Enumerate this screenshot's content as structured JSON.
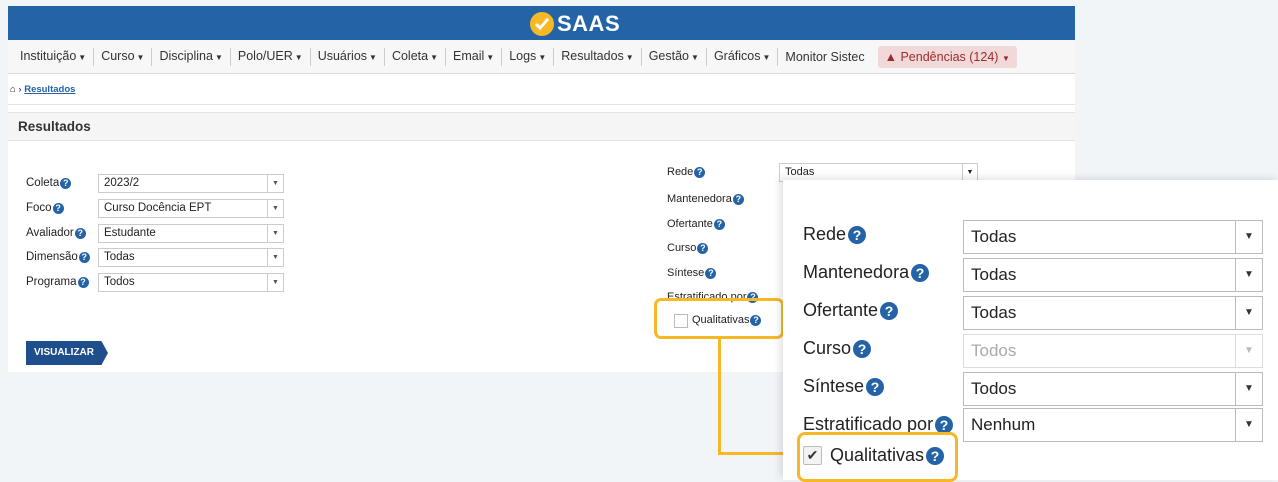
{
  "app": {
    "logo_text": "SAAS"
  },
  "nav": {
    "items": [
      "Instituição",
      "Curso",
      "Disciplina",
      "Polo/UER",
      "Usuários",
      "Coleta",
      "Email",
      "Logs",
      "Resultados",
      "Gestão",
      "Gráficos"
    ],
    "monitor": "Monitor Sistec",
    "pendencias": "Pendências (124)"
  },
  "breadcrumb": {
    "current": "Resultados"
  },
  "page": {
    "title": "Resultados"
  },
  "left_form": {
    "coleta": {
      "label": "Coleta",
      "value": "2023/2"
    },
    "foco": {
      "label": "Foco",
      "value": "Curso Docência EPT"
    },
    "avaliador": {
      "label": "Avaliador",
      "value": "Estudante"
    },
    "dimensao": {
      "label": "Dimensão",
      "value": "Todas"
    },
    "programa": {
      "label": "Programa",
      "value": "Todos"
    }
  },
  "visualizar_label": "VISUALIZAR",
  "right_form": {
    "rede": {
      "label": "Rede",
      "value": "Todas"
    },
    "mantenedora": {
      "label": "Mantenedora"
    },
    "ofertante": {
      "label": "Ofertante"
    },
    "curso": {
      "label": "Curso"
    },
    "sintese": {
      "label": "Síntese"
    },
    "estratificado": {
      "label": "Estratificado por"
    },
    "qualitativas": {
      "label": "Qualitativas",
      "checked": false
    }
  },
  "zoom_panel": {
    "rede": {
      "label": "Rede",
      "value": "Todas"
    },
    "mantenedora": {
      "label": "Mantenedora",
      "value": "Todas"
    },
    "ofertante": {
      "label": "Ofertante",
      "value": "Todas"
    },
    "curso": {
      "label": "Curso",
      "value": "Todos",
      "disabled": true
    },
    "sintese": {
      "label": "Síntese",
      "value": "Todos"
    },
    "estratificado": {
      "label": "Estratificado por",
      "value": "Nenhum"
    },
    "qualitativas": {
      "label": "Qualitativas",
      "checked": true
    }
  },
  "colors": {
    "brand_blue": "#2463a6",
    "highlight": "#f6b824",
    "button_blue": "#1e4f8c"
  }
}
